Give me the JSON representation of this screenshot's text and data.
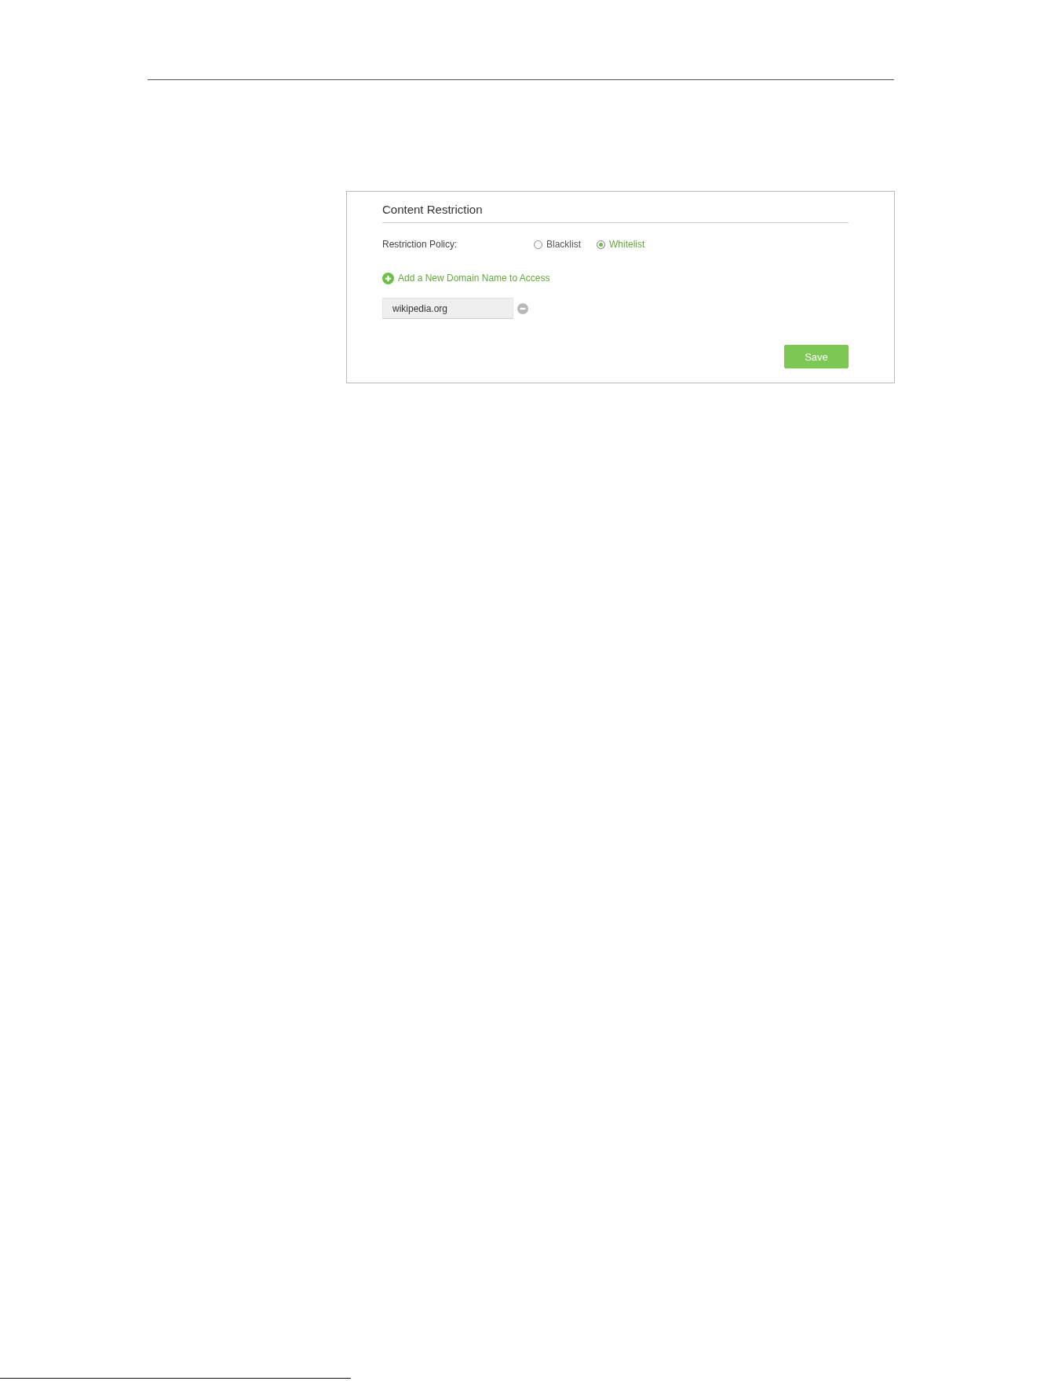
{
  "section": {
    "title": "Content Restriction"
  },
  "restriction_policy": {
    "label": "Restriction Policy:",
    "options": [
      {
        "label": "Blacklist",
        "selected": false
      },
      {
        "label": "Whitelist",
        "selected": true
      }
    ]
  },
  "add_link": {
    "label": "Add a New Domain Name to Access"
  },
  "domains": [
    {
      "value": "wikipedia.org"
    }
  ],
  "buttons": [
    {
      "label": "Save"
    }
  ]
}
